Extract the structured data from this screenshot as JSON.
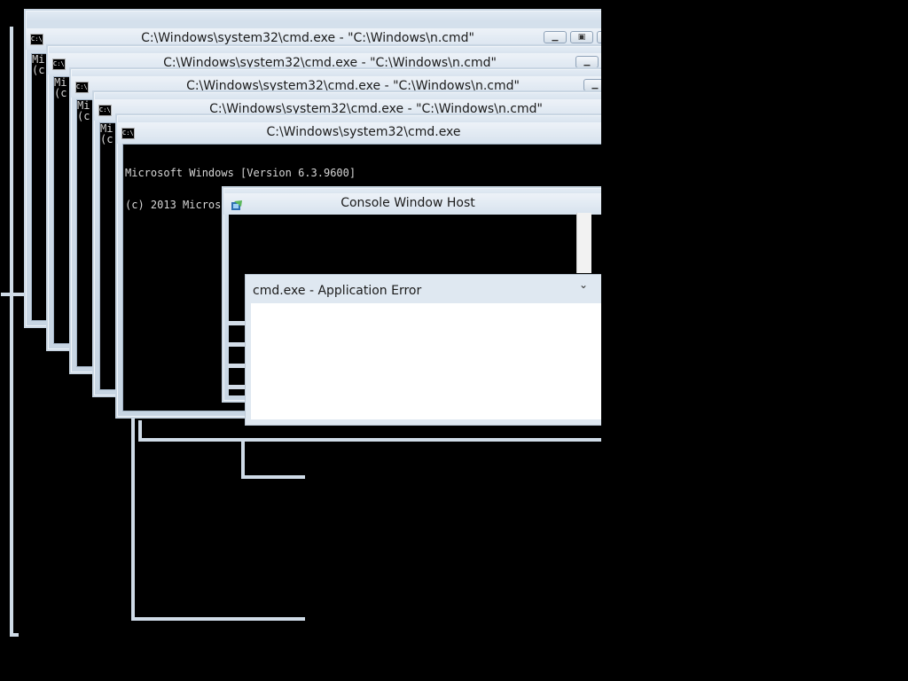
{
  "windows": {
    "cmd1": {
      "title": "C:\\Windows\\system32\\cmd.exe - \"C:\\Windows\\n.cmd\"",
      "text": "Mi\n(c"
    },
    "cmd2": {
      "title": "C:\\Windows\\system32\\cmd.exe - \"C:\\Windows\\n.cmd\"",
      "text": "Mi\n(c"
    },
    "cmd3": {
      "title": "C:\\Windows\\system32\\cmd.exe - \"C:\\Windows\\n.cmd\"",
      "text": "Mi\n(c"
    },
    "cmd4": {
      "title": "C:\\Windows\\system32\\cmd.exe - \"C:\\Windows\\n.cmd\"",
      "text": "Mi\n(c"
    },
    "cmd5": {
      "title": "C:\\Windows\\system32\\cmd.exe",
      "line1": "Microsoft Windows [Version 6.3.9600]",
      "line2": "(c) 2013 Microsoft Corporation. All rights reserved."
    },
    "console_host": {
      "title": "Console Window Host"
    },
    "app_error": {
      "title": "cmd.exe - Application Error"
    }
  },
  "icons": {
    "cmd": "cmd-icon",
    "minimize": "minimize-icon",
    "restore": "restore-icon",
    "close": "close-icon",
    "console_host": "console-host-icon",
    "chevron": "chevron-down-icon"
  },
  "colors": {
    "desktop": "#000000",
    "frame": "#c9d6e3",
    "console_bg": "#000000",
    "console_text": "#d6d6d6"
  }
}
